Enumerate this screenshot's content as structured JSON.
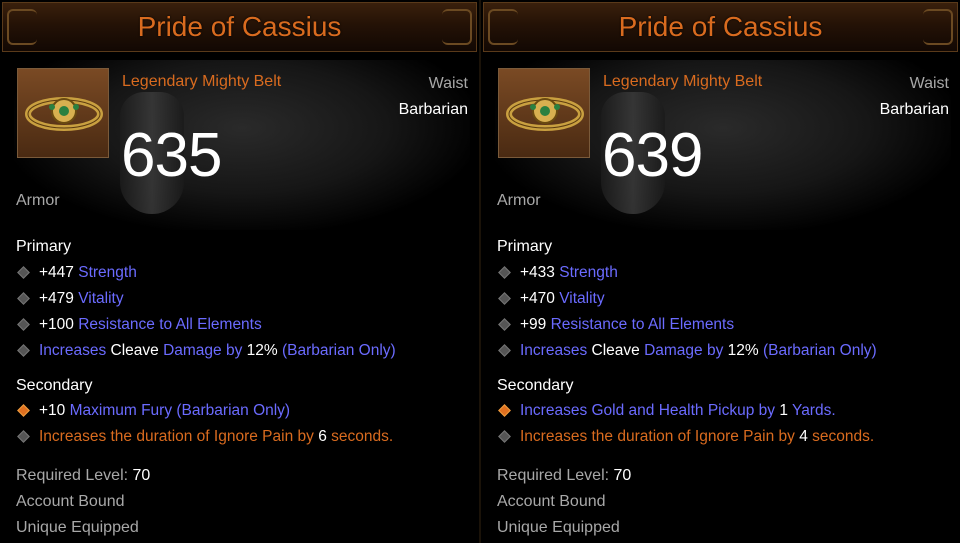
{
  "items": [
    {
      "title": "Pride of Cassius",
      "type": "Legendary Mighty Belt",
      "slot": "Waist",
      "class": "Barbarian",
      "armor": "635",
      "armor_label": "Armor",
      "primary_label": "Primary",
      "primary": [
        {
          "value": "+447",
          "stat": "Strength"
        },
        {
          "value": "+479",
          "stat": "Vitality"
        },
        {
          "value": "+100",
          "stat": "Resistance to All Elements"
        }
      ],
      "primary_special": {
        "p1": "Increases",
        "p2": "Cleave",
        "p3": "Damage by",
        "p4": "12%",
        "p5": "(Barbarian Only)"
      },
      "secondary_label": "Secondary",
      "secondary1": {
        "value": "+10",
        "text": "Maximum Fury (Barbarian Only)"
      },
      "secondary2": {
        "pre": "Increases the duration of Ignore Pain by",
        "num": "6",
        "post": "seconds."
      },
      "req_label": "Required Level:",
      "req_value": "70",
      "account_bound": "Account Bound",
      "unique_equipped": "Unique Equipped"
    },
    {
      "title": "Pride of Cassius",
      "type": "Legendary Mighty Belt",
      "slot": "Waist",
      "class": "Barbarian",
      "armor": "639",
      "armor_label": "Armor",
      "primary_label": "Primary",
      "primary": [
        {
          "value": "+433",
          "stat": "Strength"
        },
        {
          "value": "+470",
          "stat": "Vitality"
        },
        {
          "value": "+99",
          "stat": "Resistance to All Elements"
        }
      ],
      "primary_special": {
        "p1": "Increases",
        "p2": "Cleave",
        "p3": "Damage by",
        "p4": "12%",
        "p5": "(Barbarian Only)"
      },
      "secondary_label": "Secondary",
      "secondary1": {
        "pre": "Increases Gold and Health Pickup by",
        "num": "1",
        "post": "Yards."
      },
      "secondary2": {
        "pre": "Increases the duration of Ignore Pain by",
        "num": "4",
        "post": "seconds."
      },
      "req_label": "Required Level:",
      "req_value": "70",
      "account_bound": "Account Bound",
      "unique_equipped": "Unique Equipped"
    }
  ],
  "icons": {
    "item": "belt-icon",
    "bullet": "diamond-bullet-icon",
    "shield": "shield-icon"
  },
  "colors": {
    "legendary": "#d96b1f",
    "magic": "#6b6bff",
    "label": "#a8a8a8"
  }
}
